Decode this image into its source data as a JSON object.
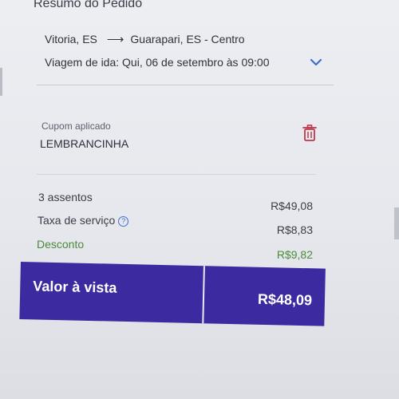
{
  "header": {
    "title": "Resumo do Pedido"
  },
  "trip": {
    "origin": "Vitoria, ES",
    "destination": "Guarapari, ES - Centro",
    "departure": "Viagem de ida: Qui, 06 de setembro às 09:00"
  },
  "coupon": {
    "label": "Cupom aplicado",
    "code": "LEMBRANCINHA"
  },
  "summary": {
    "seats_label": "3 assentos",
    "seats_value": "R$49,08",
    "fee_label": "Taxa de serviço",
    "fee_value": "R$8,83",
    "discount_label": "Desconto",
    "discount_value": "R$9,82"
  },
  "total": {
    "label": "Valor à vista",
    "value": "R$48,09"
  },
  "icons": {
    "expand": "chevron-down-icon",
    "remove": "trash-icon",
    "help": "help-icon"
  },
  "colors": {
    "accent": "#3c2aa0",
    "chevron": "#3f6fd1",
    "trash": "#c0394a",
    "discount": "#4b8a3a"
  }
}
